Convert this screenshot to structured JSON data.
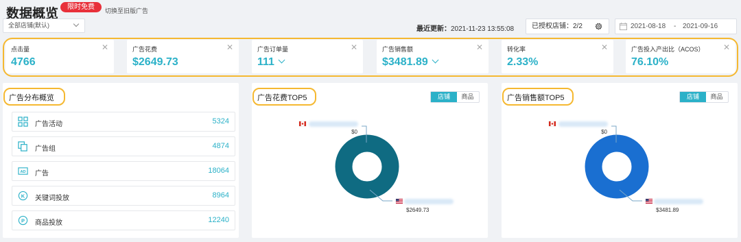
{
  "header": {
    "title": "数据概览",
    "badge": "限时免费",
    "switch_link": "切换至旧版广告",
    "store_select": "全部店铺(默认)",
    "last_update_label": "最近更新：",
    "last_update_value": "2021-11-23 13:55:08",
    "authorized_stores": "已授权店铺：2/2",
    "date_start": "2021-08-18",
    "date_sep": "-",
    "date_end": "2021-09-16"
  },
  "metrics": [
    {
      "label": "点击量",
      "value": "4766",
      "dropdown": false
    },
    {
      "label": "广告花费",
      "value": "$2649.73",
      "dropdown": false
    },
    {
      "label": "广告订单量",
      "value": "111",
      "dropdown": true
    },
    {
      "label": "广告销售额",
      "value": "$3481.89",
      "dropdown": true
    },
    {
      "label": "转化率",
      "value": "2.33%",
      "dropdown": false
    },
    {
      "label": "广告投入产出比（ACOS）",
      "value": "76.10%",
      "dropdown": false
    }
  ],
  "distribution": {
    "title": "广告分布概览",
    "items": [
      {
        "label": "广告活动",
        "value": "5324",
        "icon": "grid-icon"
      },
      {
        "label": "广告组",
        "value": "4874",
        "icon": "copy-icon"
      },
      {
        "label": "广告",
        "value": "18064",
        "icon": "ad-icon"
      },
      {
        "label": "关键词投放",
        "value": "8964",
        "icon": "keyword-k-icon"
      },
      {
        "label": "商品投放",
        "value": "12240",
        "icon": "product-p-icon"
      }
    ]
  },
  "spend_top5": {
    "title": "广告花费TOP5",
    "tab_store": "店铺",
    "tab_product": "商品",
    "ring_color": "#0f6b82",
    "top_label": "$0",
    "bottom_label": "$2649.73"
  },
  "sales_top5": {
    "title": "广告销售额TOP5",
    "tab_store": "店铺",
    "tab_product": "商品",
    "ring_color": "#1a6fd1",
    "top_label": "$0",
    "bottom_label": "$3481.89"
  },
  "colors": {
    "accent": "#2bb1c8",
    "highlight_outline": "#f5b830",
    "badge_red": "#e8303a"
  }
}
